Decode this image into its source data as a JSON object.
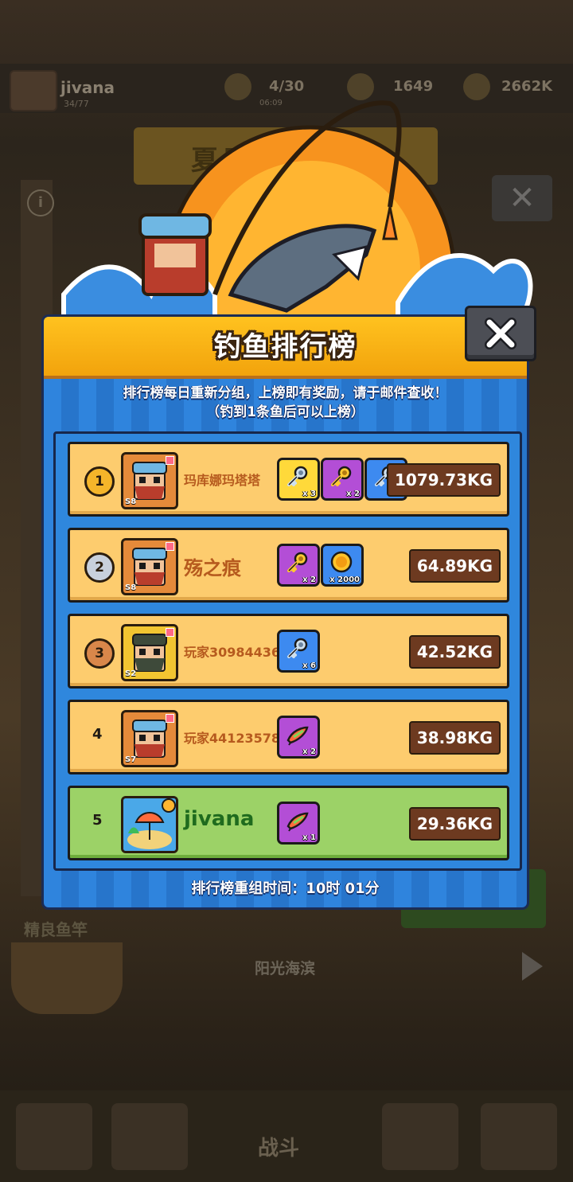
{
  "background": {
    "player_name": "jivana",
    "player_sub": "34/77",
    "stamina": "4/30",
    "stamina_sub": "06:09",
    "gems": "1649",
    "coins": "2662K",
    "event_title": "夏日海滨狂欢",
    "rod_label": "精良鱼竿",
    "location": "阳光海滨",
    "fight_label": "战斗"
  },
  "leaderboard": {
    "title": "钓鱼排行榜",
    "notice_line1": "排行榜每日重新分组，上榜即有奖励，请于邮件查收！",
    "notice_line2": "（钓到1条鱼后可以上榜）",
    "footer": "排行榜重组时间：10时 01分",
    "rows": [
      {
        "rank": "1",
        "name": "玛库娜玛塔塔",
        "tier": "S8",
        "weight": "1079.73KG",
        "medal_color": "#f5b52a",
        "rewards": [
          {
            "icon": "silver-key-icon",
            "count": "x 3",
            "color": "yellow"
          },
          {
            "icon": "gold-key-icon",
            "count": "x 2",
            "color": "purple"
          },
          {
            "icon": "silver-key-icon",
            "count": "x 6",
            "color": "blue"
          }
        ]
      },
      {
        "rank": "2",
        "name": "殇之痕",
        "tier": "S8",
        "weight": "64.89KG",
        "medal_color": "#c8d0dc",
        "rewards": [
          {
            "icon": "gold-key-icon",
            "count": "x 2",
            "color": "purple"
          },
          {
            "icon": "gold-coin-icon",
            "count": "x 2000",
            "color": "blue"
          }
        ]
      },
      {
        "rank": "3",
        "name": "玩家30984436",
        "tier": "S2",
        "weight": "42.52KG",
        "medal_color": "#d9874a",
        "rewards": [
          {
            "icon": "silver-key-icon",
            "count": "x 6",
            "color": "blue"
          }
        ]
      },
      {
        "rank": "4",
        "name": "玩家44123578",
        "tier": "S7",
        "weight": "38.98KG",
        "medal_color": "",
        "rewards": [
          {
            "icon": "fishing-lure-icon",
            "count": "x 2",
            "color": "purple"
          }
        ]
      },
      {
        "rank": "5",
        "name": "jivana",
        "tier": "",
        "weight": "29.36KG",
        "medal_color": "",
        "rewards": [
          {
            "icon": "fishing-lure-icon",
            "count": "x 1",
            "color": "purple"
          }
        ]
      }
    ]
  }
}
